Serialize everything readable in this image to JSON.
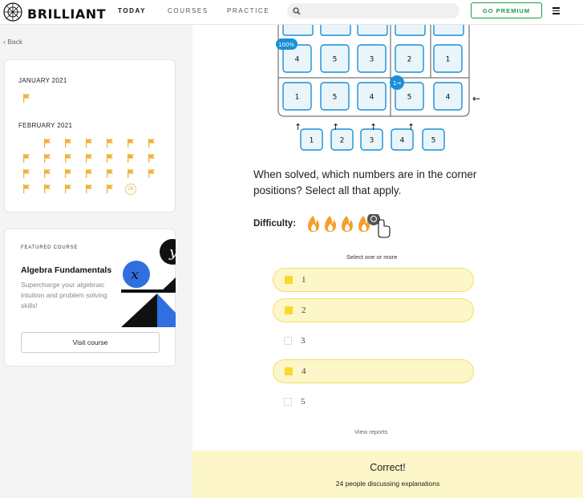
{
  "header": {
    "brand": "BRILLIANT",
    "nav": [
      "TODAY",
      "COURSES",
      "PRACTICE"
    ],
    "search_placeholder": "",
    "premium_label": "GO PREMIUM",
    "icons": [
      "brilliant-logo-icon",
      "search-icon",
      "menu-icon"
    ]
  },
  "sidebar": {
    "back_label": "Back",
    "calendar": {
      "months": [
        {
          "label": "JANUARY 2021",
          "flags": 1
        },
        {
          "label": "FEBRUARY 2021",
          "flags": 25,
          "current_day": "26"
        }
      ],
      "flag_color": "#f2b13c"
    },
    "featured_course": {
      "eyebrow": "FEATURED COURSE",
      "title": "Algebra Fundamentals",
      "description": "Supercharge your algebraic intuition and problem solving skills!",
      "button_label": "Visit course",
      "art_letters": [
        "x",
        "y"
      ]
    }
  },
  "puzzle": {
    "badges": {
      "top_left": "100%",
      "inner": "1→"
    },
    "row1": [
      "4",
      "5",
      "3",
      "2",
      "1"
    ],
    "row2": [
      "1",
      "5",
      "4",
      "5",
      "4"
    ],
    "bottom": [
      "1",
      "2",
      "3",
      "4",
      "5"
    ],
    "arrow_right": "←",
    "arrow_up": "↑"
  },
  "question": {
    "text": "When solved, which numbers are in the corner positions? Select all that apply.",
    "difficulty_label": "Difficulty:",
    "difficulty_level": 4,
    "select_hint": "Select one or more",
    "options": [
      {
        "label": "1",
        "selected": true
      },
      {
        "label": "2",
        "selected": true
      },
      {
        "label": "3",
        "selected": false
      },
      {
        "label": "4",
        "selected": true
      },
      {
        "label": "5",
        "selected": false
      }
    ],
    "view_reports": "View reports"
  },
  "result": {
    "title": "Correct!",
    "subtitle": "24 people discussing explanations"
  },
  "colors": {
    "accent_blue": "#1a8fd6",
    "premium_green": "#1e9a44",
    "highlight": "#fdf6c8",
    "check": "#f7d92a"
  }
}
